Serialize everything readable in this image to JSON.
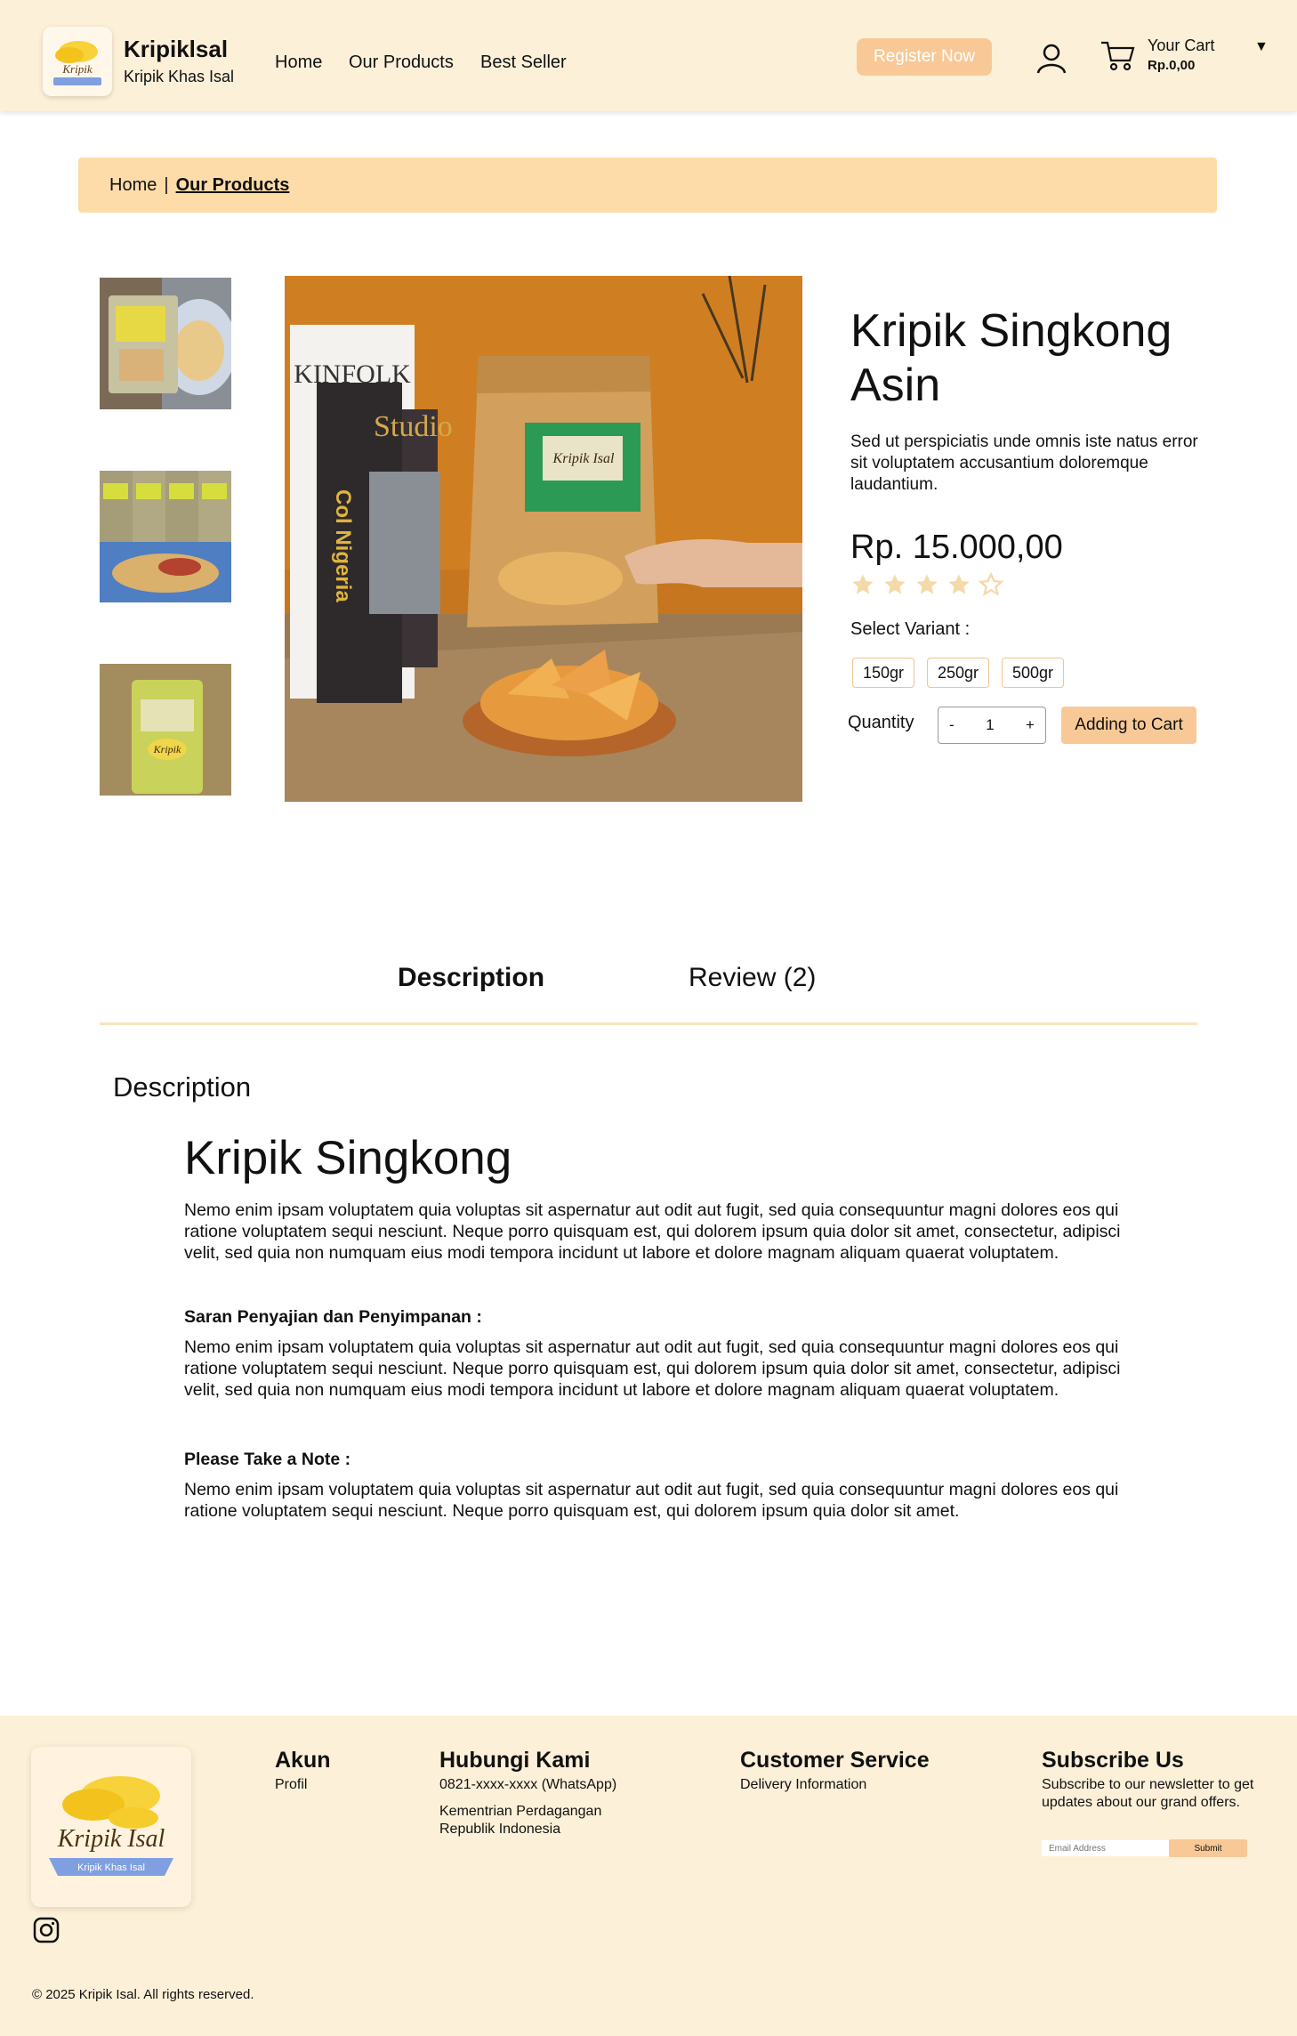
{
  "header": {
    "brand_title": "Kripiklsal",
    "brand_subtitle": "Kripik Khas Isal",
    "nav": [
      "Home",
      "Our Products",
      "Best Seller"
    ],
    "register_label": "Register Now",
    "cart_label": "Your Cart",
    "cart_total": "Rp.0,00",
    "cart_caret": "▼"
  },
  "breadcrumb": {
    "home": "Home",
    "separator": "|",
    "current": "Our Products"
  },
  "product": {
    "title": "Kripik Singkong Asin",
    "description": "Sed ut perspiciatis unde omnis iste natus error sit voluptatem  accusantium doloremque laudantium.",
    "price": "Rp. 15.000,00",
    "rating": 4,
    "rating_max": 5,
    "variant_label": "Select Variant :",
    "variants": [
      "150gr",
      "250gr",
      "500gr"
    ],
    "quantity_label": "Quantity",
    "qty_minus": "-",
    "quantity": "1",
    "qty_plus": "+",
    "add_to_cart": "Adding to Cart"
  },
  "tabs": {
    "description": "Description",
    "review": "Review (2)"
  },
  "content": {
    "section_heading": "Description",
    "title": "Kripik Singkong",
    "para1": "Nemo enim ipsam voluptatem quia voluptas sit aspernatur aut odit aut  fugit, sed quia consequuntur magni dolores eos qui ratione voluptatem  sequi nesciunt. Neque porro quisquam est, qui dolorem ipsum quia dolor  sit amet, consectetur, adipisci velit, sed quia non numquam eius modi  tempora incidunt ut labore et dolore magnam aliquam quaerat voluptatem.",
    "head2": "Saran Penyajian dan Penyimpanan :",
    "para2": "Nemo enim ipsam voluptatem quia voluptas sit aspernatur aut odit aut  fugit, sed quia consequuntur magni dolores eos qui ratione voluptatem  sequi nesciunt. Neque porro quisquam est, qui dolorem ipsum quia dolor  sit amet, consectetur, adipisci velit, sed quia non numquam eius modi  tempora incidunt ut labore et dolore magnam aliquam quaerat voluptatem.",
    "head3": "Please Take a Note :",
    "para3": "Nemo enim ipsam voluptatem quia voluptas sit aspernatur aut odit aut  fugit, sed quia consequuntur magni dolores eos qui ratione voluptatem  sequi nesciunt. Neque porro quisquam est, qui dolorem ipsum quia dolor  sit amet."
  },
  "footer": {
    "akun_title": "Akun",
    "akun_items": [
      "Profil"
    ],
    "hubungi_title": "Hubungi Kami",
    "hubungi_phone": "0821-xxxx-xxxx (WhatsApp)",
    "hubungi_org": "Kementrian Perdagangan Republik Indonesia",
    "cs_title": "Customer Service",
    "cs_items": [
      "Delivery Information"
    ],
    "subscribe_title": "Subscribe Us",
    "subscribe_text": "Subscribe to our newsletter to get updates about our grand offers.",
    "email_placeholder": "Email Address",
    "submit_label": "Submit",
    "copyright": "© 2025 Kripik Isal. All rights reserved.",
    "logo_text": "Kripik Isal",
    "logo_ribbon": "Kripik Khas Isal"
  },
  "colors": {
    "header_bg": "#fdf0d8",
    "accent": "#f8c996",
    "breadcrumb_bg": "#fddcaa",
    "star": "#f5d9a8"
  },
  "icons": [
    "user-icon",
    "cart-icon",
    "star-icon",
    "instagram-icon"
  ]
}
